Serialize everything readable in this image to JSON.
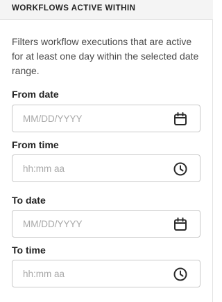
{
  "header": {
    "title": "WORKFLOWS ACTIVE WITHIN"
  },
  "description": "Filters workflow executions that are active for at least one day within the selected date range.",
  "fields": {
    "from_date": {
      "label": "From date",
      "value": "",
      "placeholder": "MM/DD/YYYY",
      "icon": "calendar-icon"
    },
    "from_time": {
      "label": "From time",
      "value": "",
      "placeholder": "hh:mm aa",
      "icon": "clock-icon"
    },
    "to_date": {
      "label": "To date",
      "value": "",
      "placeholder": "MM/DD/YYYY",
      "icon": "calendar-icon"
    },
    "to_time": {
      "label": "To time",
      "value": "",
      "placeholder": "hh:mm aa",
      "icon": "clock-icon"
    }
  },
  "colors": {
    "header_bg": "#f4f4f4",
    "border": "#c9c9c9",
    "placeholder": "#a8a8a8",
    "icon": "#2b2b2b"
  }
}
